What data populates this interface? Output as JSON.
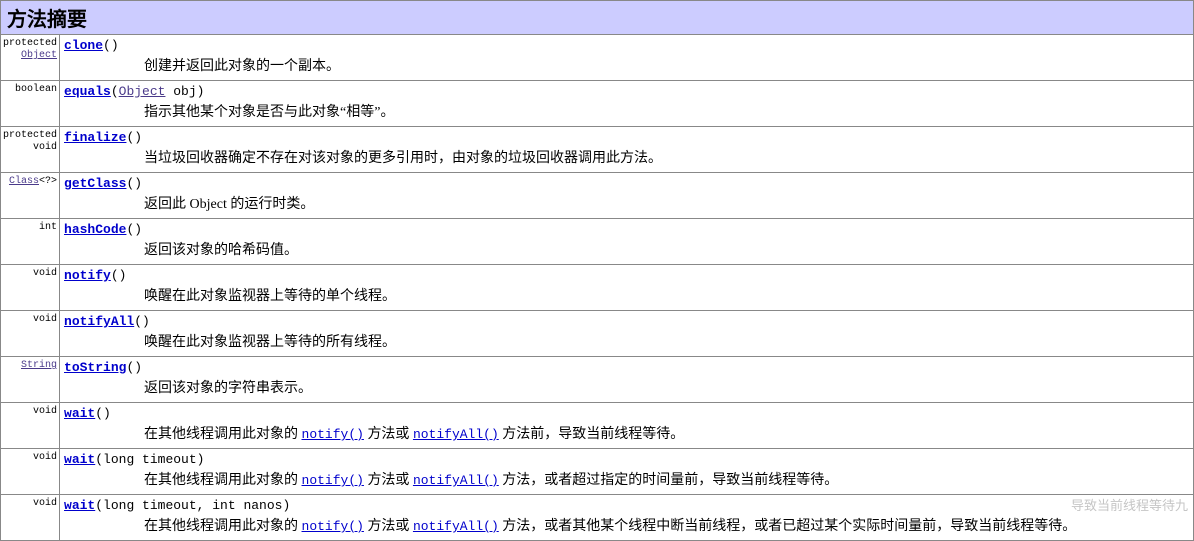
{
  "title": "方法摘要",
  "rows": [
    {
      "ret_plain_pre": "protected ",
      "ret_link": "Object",
      "ret_plain_post": "",
      "method": "clone",
      "params_html": "()",
      "desc_html": "创建并返回此对象的一个副本。"
    },
    {
      "ret_plain_pre": "boolean",
      "ret_link": "",
      "ret_plain_post": "",
      "method": "equals",
      "params_html": "(<a class=\"type\" href=\"#\">Object</a> obj)",
      "desc_html": "指示其他某个对象是否与此对象“相等”。"
    },
    {
      "ret_plain_pre": "protected void",
      "ret_link": "",
      "ret_plain_post": "",
      "method": "finalize",
      "params_html": "()",
      "desc_html": "当垃圾回收器确定不存在对该对象的更多引用时，由对象的垃圾回收器调用此方法。"
    },
    {
      "ret_plain_pre": "",
      "ret_link": "Class",
      "ret_plain_post": "<?>",
      "method": "getClass",
      "params_html": "()",
      "desc_html": "返回此 Object 的运行时类。"
    },
    {
      "ret_plain_pre": "int",
      "ret_link": "",
      "ret_plain_post": "",
      "method": "hashCode",
      "params_html": "()",
      "desc_html": "返回该对象的哈希码值。"
    },
    {
      "ret_plain_pre": "void",
      "ret_link": "",
      "ret_plain_post": "",
      "method": "notify",
      "params_html": "()",
      "desc_html": "唤醒在此对象监视器上等待的单个线程。"
    },
    {
      "ret_plain_pre": "void",
      "ret_link": "",
      "ret_plain_post": "",
      "method": "notifyAll",
      "params_html": "()",
      "desc_html": "唤醒在此对象监视器上等待的所有线程。"
    },
    {
      "ret_plain_pre": "",
      "ret_link": "String",
      "ret_plain_post": "",
      "method": "toString",
      "params_html": "()",
      "desc_html": "返回该对象的字符串表示。"
    },
    {
      "ret_plain_pre": "void",
      "ret_link": "",
      "ret_plain_post": "",
      "method": "wait",
      "params_html": "()",
      "desc_html": "在其他线程调用此对象的 <a class=\"ilink\" href=\"#\">notify()</a> 方法或 <a class=\"ilink\" href=\"#\">notifyAll()</a> 方法前，导致当前线程等待。"
    },
    {
      "ret_plain_pre": "void",
      "ret_link": "",
      "ret_plain_post": "",
      "method": "wait",
      "params_html": "(long timeout)",
      "desc_html": "在其他线程调用此对象的 <a class=\"ilink\" href=\"#\">notify()</a> 方法或 <a class=\"ilink\" href=\"#\">notifyAll()</a> 方法，或者超过指定的时间量前，导致当前线程等待。"
    },
    {
      "ret_plain_pre": "void",
      "ret_link": "",
      "ret_plain_post": "",
      "method": "wait",
      "params_html": "(long timeout, int nanos)",
      "desc_html": "在其他线程调用此对象的 <a class=\"ilink\" href=\"#\">notify()</a> 方法或 <a class=\"ilink\" href=\"#\">notifyAll()</a> 方法，或者其他某个线程中断当前线程，或者已超过某个实际时间量前，导致当前线程等待。"
    }
  ],
  "watermark": "导致当前线程等待九"
}
